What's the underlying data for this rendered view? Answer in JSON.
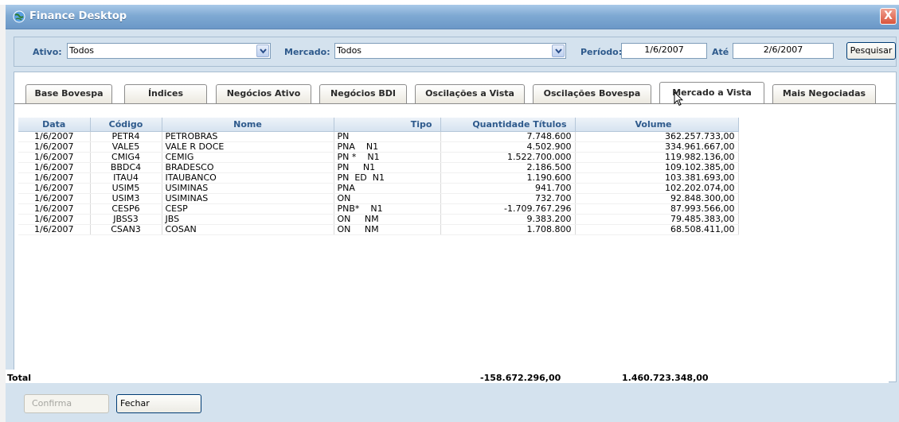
{
  "window": {
    "title": "Finance Desktop",
    "close_symbol": "X"
  },
  "filters": {
    "ativo_label": "Ativo:",
    "ativo_value": "Todos",
    "mercado_label": "Mercado:",
    "mercado_value": "Todos",
    "periodo_label": "Período:",
    "periodo_from": "1/6/2007",
    "ate_label": "Até",
    "periodo_to": "2/6/2007",
    "search_label": "Pesquisar"
  },
  "tabs": [
    {
      "label": "Base Bovespa"
    },
    {
      "label": "Índices"
    },
    {
      "label": "Negócios Ativo"
    },
    {
      "label": "Negócios BDI"
    },
    {
      "label": "Oscilações a Vista"
    },
    {
      "label": "Oscilações Bovespa"
    },
    {
      "label": "Mercado a Vista"
    },
    {
      "label": "Mais Negociadas"
    }
  ],
  "active_tab": "Mercado a Vista",
  "table": {
    "columns": [
      "Data",
      "Código",
      "Nome",
      "Tipo",
      "Quantidade Títulos",
      "Volume"
    ],
    "rows": [
      [
        "1/6/2007",
        "PETR4",
        "PETROBRAS",
        "PN",
        "7.748.600",
        "362.257.733,00"
      ],
      [
        "1/6/2007",
        "VALE5",
        "VALE R DOCE",
        "PNA    N1",
        "4.502.900",
        "334.961.667,00"
      ],
      [
        "1/6/2007",
        "CMIG4",
        "CEMIG",
        "PN *    N1",
        "1.522.700.000",
        "119.982.136,00"
      ],
      [
        "1/6/2007",
        "BBDC4",
        "BRADESCO",
        "PN     N1",
        "2.186.500",
        "109.102.385,00"
      ],
      [
        "1/6/2007",
        "ITAU4",
        "ITAUBANCO",
        "PN  ED  N1",
        "1.190.600",
        "103.381.693,00"
      ],
      [
        "1/6/2007",
        "USIM5",
        "USIMINAS",
        "PNA",
        "941.700",
        "102.202.074,00"
      ],
      [
        "1/6/2007",
        "USIM3",
        "USIMINAS",
        "ON",
        "732.700",
        "92.848.300,00"
      ],
      [
        "1/6/2007",
        "CESP6",
        "CESP",
        "PNB*    N1",
        "-1.709.767.296",
        "87.993.566,00"
      ],
      [
        "1/6/2007",
        "JBSS3",
        "JBS",
        "ON     NM",
        "9.383.200",
        "79.485.383,00"
      ],
      [
        "1/6/2007",
        "CSAN3",
        "COSAN",
        "ON     NM",
        "1.708.800",
        "68.508.411,00"
      ]
    ]
  },
  "totals": {
    "label": "Total",
    "quantidade": "-158.672.296,00",
    "volume": "1.460.723.348,00"
  },
  "footer": {
    "confirm_label": "Confirma",
    "close_label": "Fechar"
  },
  "colors": {
    "title_bar": "#7fa9d3",
    "panel": "#d4e2ee",
    "label_blue": "#2e5a8c",
    "close_red": "#d9543c"
  },
  "icons": {
    "app": "globe-icon",
    "close": "close-icon",
    "dropdown": "chevron-down-icon",
    "cursor": "mouse-pointer-icon"
  }
}
